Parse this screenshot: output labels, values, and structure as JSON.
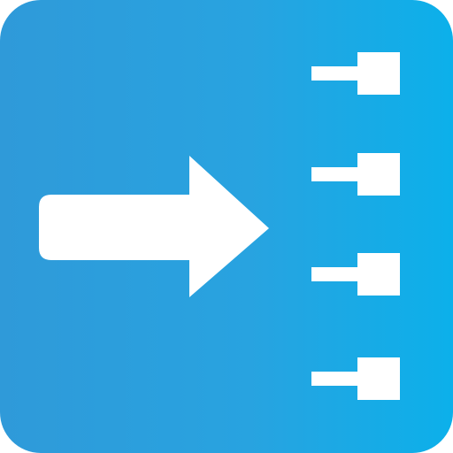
{
  "icon": {
    "name": "arrow-to-connectors-app-icon",
    "colors": {
      "background_left": "#2f9ad9",
      "background_mid": "#28a3e0",
      "background_right": "#0cb0ea",
      "foreground": "#ffffff"
    },
    "connectors": [
      {
        "name": "connector-pin-1"
      },
      {
        "name": "connector-pin-2"
      },
      {
        "name": "connector-pin-3"
      },
      {
        "name": "connector-pin-4"
      }
    ]
  }
}
